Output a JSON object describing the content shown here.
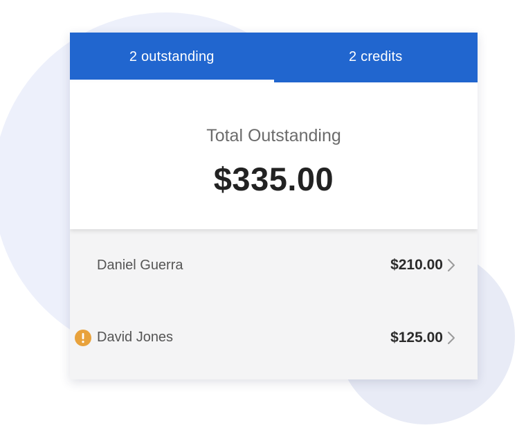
{
  "tabs": [
    {
      "label": "2 outstanding",
      "active": true
    },
    {
      "label": "2 credits",
      "active": false
    }
  ],
  "summary": {
    "label": "Total Outstanding",
    "amount": "$335.00"
  },
  "rows": [
    {
      "name": "Daniel Guerra",
      "amount": "$210.00",
      "icon": "chevron-right-icon"
    },
    {
      "name": "David Jones",
      "amount": "$125.00",
      "icon": "chevron-right-icon",
      "alert_icon": "warning-icon"
    }
  ],
  "colors": {
    "accent": "#2166cf",
    "warning": "#e8a23c",
    "text_primary": "#222222",
    "text_secondary": "#6b6b6b",
    "background_blob": "#edf0fb"
  }
}
